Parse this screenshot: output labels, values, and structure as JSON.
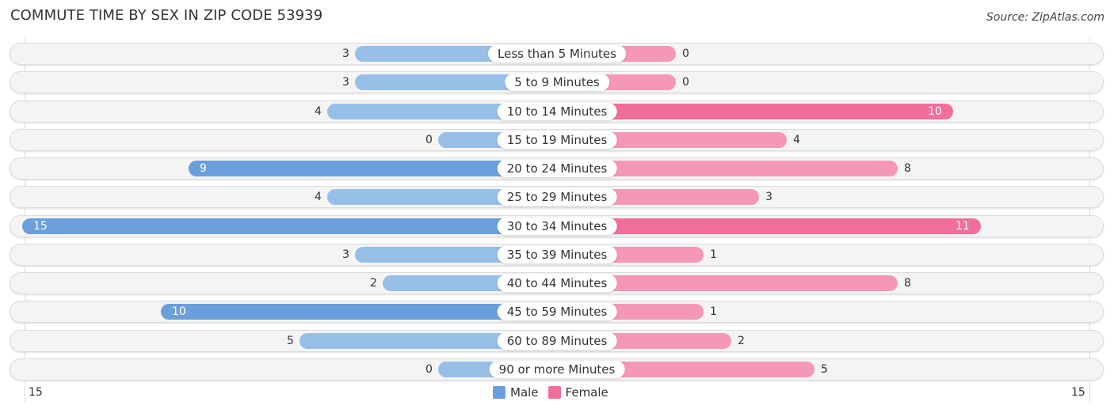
{
  "chart_data": {
    "type": "bar",
    "orientation": "horizontal-diverging",
    "title": "COMMUTE TIME BY SEX IN ZIP CODE 53939",
    "source": "Source: ZipAtlas.com",
    "categories": [
      "Less than 5 Minutes",
      "5 to 9 Minutes",
      "10 to 14 Minutes",
      "15 to 19 Minutes",
      "20 to 24 Minutes",
      "25 to 29 Minutes",
      "30 to 34 Minutes",
      "35 to 39 Minutes",
      "40 to 44 Minutes",
      "45 to 59 Minutes",
      "60 to 89 Minutes",
      "90 or more Minutes"
    ],
    "series": [
      {
        "name": "Male",
        "color": "#6a9fdb",
        "values": [
          3,
          3,
          4,
          0,
          9,
          4,
          15,
          3,
          2,
          10,
          5,
          0
        ]
      },
      {
        "name": "Female",
        "color": "#f06e98",
        "values": [
          0,
          0,
          10,
          4,
          8,
          3,
          11,
          1,
          8,
          1,
          2,
          5
        ]
      }
    ],
    "axis": {
      "left_label": "15",
      "right_label": "15",
      "max": 15
    },
    "legend": {
      "position": "bottom-center",
      "items": [
        "Male",
        "Female"
      ]
    }
  }
}
